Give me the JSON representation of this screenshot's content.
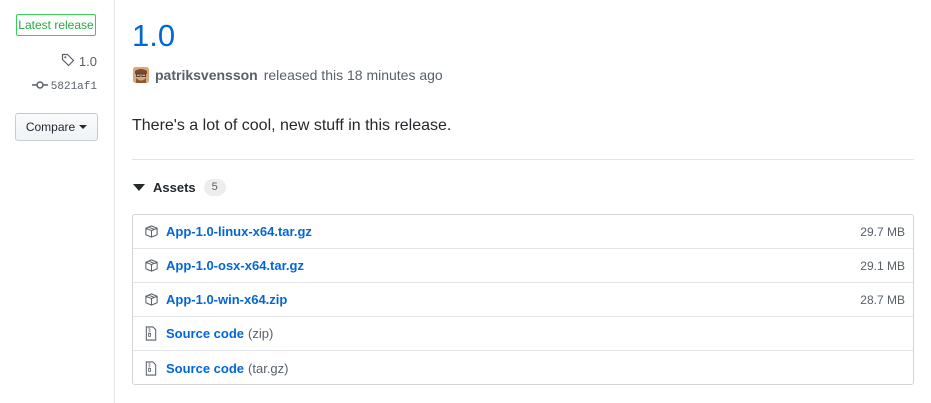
{
  "sidebar": {
    "badge": "Latest release",
    "tag": "1.0",
    "commit": "5821af1",
    "compare_label": "Compare"
  },
  "release": {
    "title": "1.0",
    "author": "patriksvensson",
    "released_text": "released this 18 minutes ago",
    "description": "There's a lot of cool, new stuff in this release."
  },
  "assets": {
    "header": "Assets",
    "count": "5",
    "files": [
      {
        "name": "App-1.0-linux-x64.tar.gz",
        "size": "29.7 MB",
        "icon": "package-icon"
      },
      {
        "name": "App-1.0-osx-x64.tar.gz",
        "size": "29.1 MB",
        "icon": "package-icon"
      },
      {
        "name": "App-1.0-win-x64.zip",
        "size": "28.7 MB",
        "icon": "package-icon"
      }
    ],
    "source": [
      {
        "label": "Source code",
        "format": "(zip)",
        "icon": "file-zip-icon"
      },
      {
        "label": "Source code",
        "format": "(tar.gz)",
        "icon": "file-zip-icon"
      }
    ]
  },
  "colors": {
    "link": "#0366d6",
    "badge_green": "#28a745",
    "muted": "#586069"
  }
}
